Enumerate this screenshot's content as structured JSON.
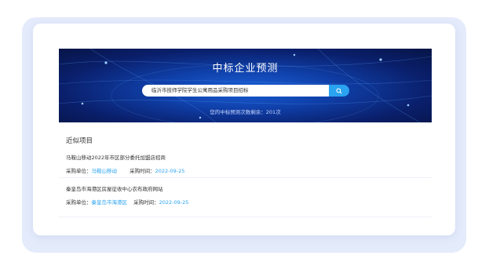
{
  "banner": {
    "title": "中标企业预测",
    "search_value": "临沂市技师学院学生公寓用品采购项目招标",
    "quota_text": "您的中标预测次数剩余：201次"
  },
  "similar": {
    "heading": "近似项目",
    "items": [
      {
        "title": "马鞍山移动2022年市区部分委托加盟店招商",
        "unit_label": "采购单位：",
        "unit_value": "马鞍山移动",
        "time_label": "采购时间：",
        "time_value": "2022-09-25"
      },
      {
        "title": "秦皇岛市海港区房屋征收中心农布政府网站",
        "unit_label": "采购单位：",
        "unit_value": "秦皇岛市海港区",
        "time_label": "采购时间：",
        "time_value": "2022-09-25"
      }
    ]
  },
  "colors": {
    "accent": "#2aa3f0",
    "banner_dark": "#0a1f6b"
  },
  "icons": {
    "search": "search-icon"
  }
}
